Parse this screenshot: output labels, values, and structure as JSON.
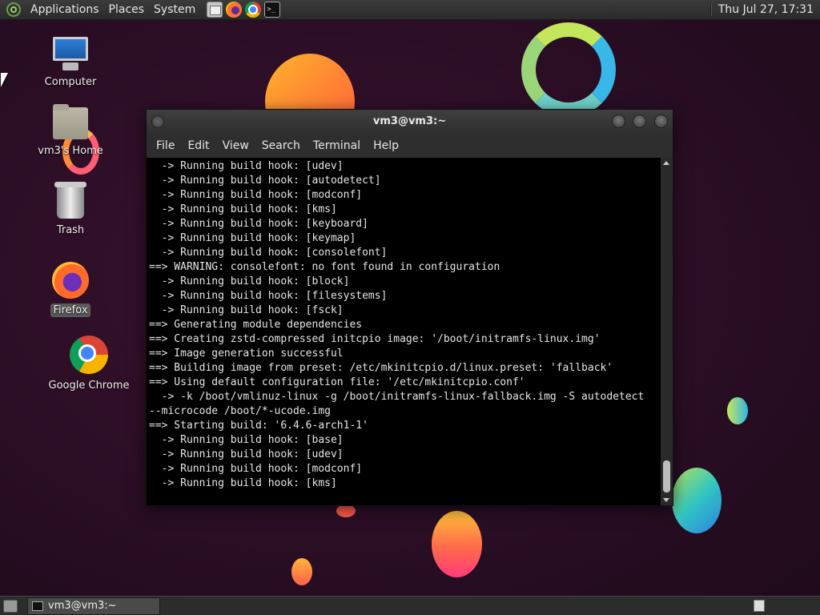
{
  "top_panel": {
    "menus": [
      "Applications",
      "Places",
      "System"
    ],
    "clock": "Thu Jul 27, 17:31",
    "launchers": [
      "files-icon",
      "firefox-icon",
      "chrome-icon",
      "terminal-icon"
    ]
  },
  "desktop": {
    "icons": [
      {
        "label": "Computer",
        "icon": "computer-icon"
      },
      {
        "label": "vm3's Home",
        "icon": "home-folder-icon"
      },
      {
        "label": "Trash",
        "icon": "trash-icon"
      },
      {
        "label": "Firefox",
        "icon": "firefox-icon",
        "selected": true
      },
      {
        "label": "Google Chrome",
        "icon": "chrome-icon"
      }
    ]
  },
  "window": {
    "title": "vm3@vm3:~",
    "menu": [
      "File",
      "Edit",
      "View",
      "Search",
      "Terminal",
      "Help"
    ],
    "terminal_lines": [
      "  -> Running build hook: [udev]",
      "  -> Running build hook: [autodetect]",
      "  -> Running build hook: [modconf]",
      "  -> Running build hook: [kms]",
      "  -> Running build hook: [keyboard]",
      "  -> Running build hook: [keymap]",
      "  -> Running build hook: [consolefont]",
      "==> WARNING: consolefont: no font found in configuration",
      "  -> Running build hook: [block]",
      "  -> Running build hook: [filesystems]",
      "  -> Running build hook: [fsck]",
      "==> Generating module dependencies",
      "==> Creating zstd-compressed initcpio image: '/boot/initramfs-linux.img'",
      "==> Image generation successful",
      "==> Building image from preset: /etc/mkinitcpio.d/linux.preset: 'fallback'",
      "==> Using default configuration file: '/etc/mkinitcpio.conf'",
      "  -> -k /boot/vmlinuz-linux -g /boot/initramfs-linux-fallback.img -S autodetect",
      "--microcode /boot/*-ucode.img",
      "==> Starting build: '6.4.6-arch1-1'",
      "  -> Running build hook: [base]",
      "  -> Running build hook: [udev]",
      "  -> Running build hook: [modconf]",
      "  -> Running build hook: [kms]"
    ]
  },
  "bottom_panel": {
    "tasks": [
      {
        "label": "vm3@vm3:~",
        "icon": "terminal-icon"
      }
    ]
  },
  "colors": {
    "wallpaper": "#2a0e24",
    "panel": "#2c2c2c",
    "terminal_bg": "#000000",
    "terminal_fg": "#e6e6e6"
  }
}
